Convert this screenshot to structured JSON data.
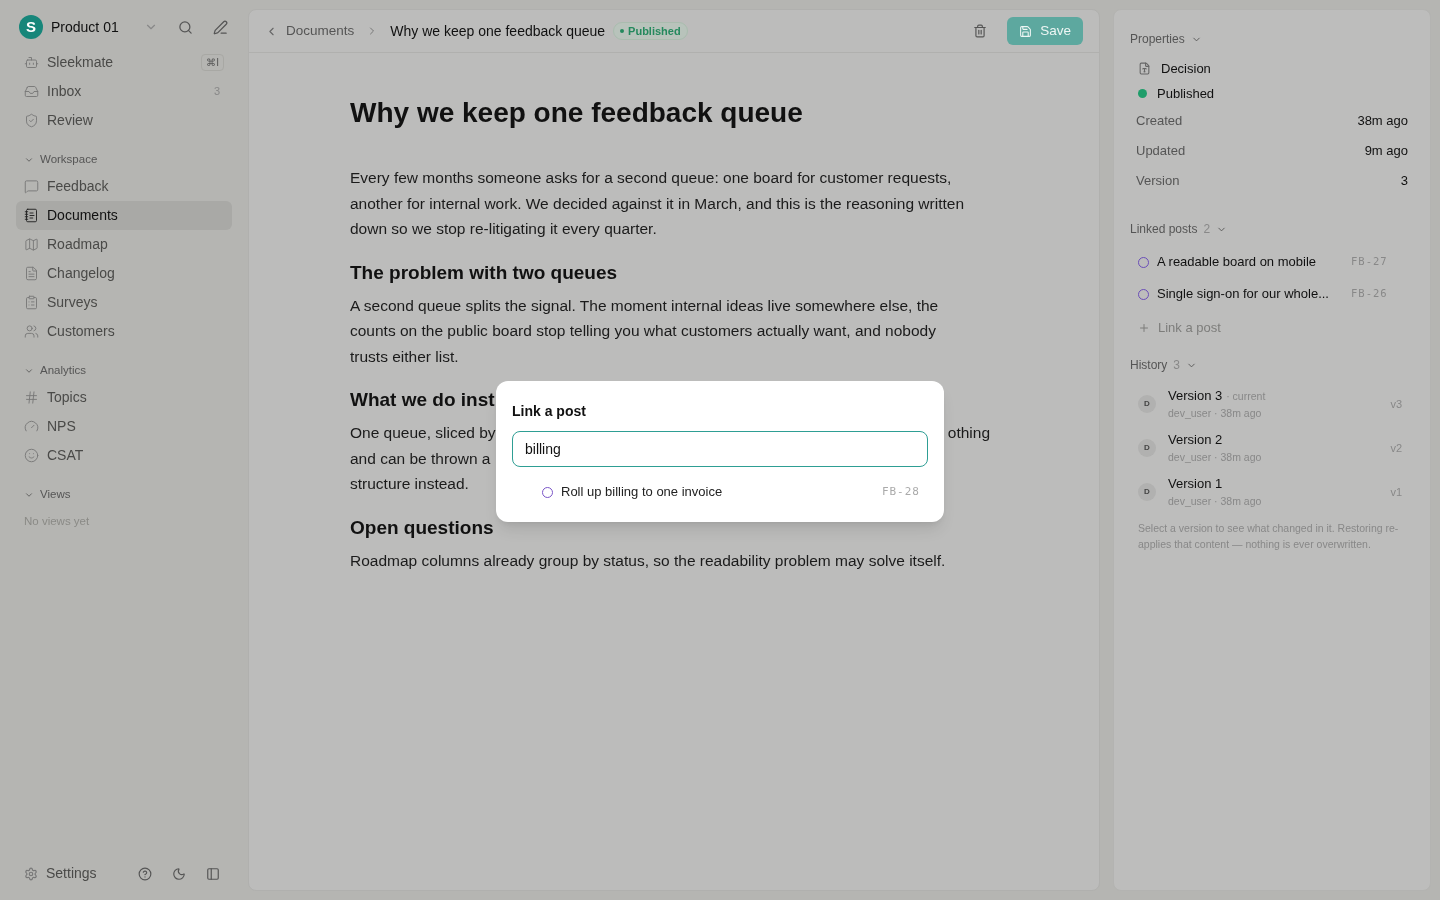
{
  "workspace": {
    "initial": "S",
    "name": "Product 01"
  },
  "sidebar": {
    "top_items": [
      {
        "label": "Sleekmate",
        "shortcut": "⌘I",
        "selected": false
      },
      {
        "label": "Inbox",
        "count": "3",
        "selected": false
      },
      {
        "label": "Review",
        "selected": false
      }
    ],
    "sections": [
      {
        "title": "Workspace",
        "expanded": true,
        "items": [
          {
            "label": "Feedback",
            "selected": false
          },
          {
            "label": "Documents",
            "selected": true
          },
          {
            "label": "Roadmap",
            "selected": false
          },
          {
            "label": "Changelog",
            "selected": false
          },
          {
            "label": "Surveys",
            "selected": false
          },
          {
            "label": "Customers",
            "selected": false
          }
        ]
      },
      {
        "title": "Analytics",
        "expanded": true,
        "items": [
          {
            "label": "Topics",
            "selected": false
          },
          {
            "label": "NPS",
            "selected": false
          },
          {
            "label": "CSAT",
            "selected": false
          }
        ]
      },
      {
        "title": "Views",
        "expanded": true,
        "empty_text": "No views yet"
      }
    ],
    "footer": {
      "settings": "Settings"
    }
  },
  "breadcrumb": {
    "parent": "Documents",
    "current": "Why we keep one feedback queue",
    "status": "Published"
  },
  "toolbar": {
    "save": "Save"
  },
  "document": {
    "title": "Why we keep one feedback queue",
    "blocks": [
      {
        "kind": "paragraph",
        "text": "Every few months someone asks for a second queue: one board for customer requests, another for internal work. We decided against it in March, and this is the reasoning written down so we stop re-litigating it every quarter."
      },
      {
        "kind": "heading",
        "text": "The problem with two queues"
      },
      {
        "kind": "paragraph",
        "text": "A second queue splits the signal. The moment internal ideas live somewhere else, the counts on the public board stop telling you what customers actually want, and nobody trusts either list."
      },
      {
        "kind": "heading",
        "text": "What we do inst"
      },
      {
        "kind": "lines",
        "lines": [
          {
            "left": "One queue, sliced by",
            "right": "othing"
          },
          {
            "left": "and can be thrown a"
          },
          {
            "left": "structure instead."
          }
        ]
      },
      {
        "kind": "heading",
        "text": "Open questions"
      },
      {
        "kind": "paragraph",
        "text": "Roadmap columns already group by status, so the readability problem may solve itself."
      }
    ]
  },
  "properties": {
    "title": "Properties",
    "type": "Decision",
    "status": "Published",
    "rows": [
      {
        "label": "Created",
        "value": "38m ago"
      },
      {
        "label": "Updated",
        "value": "9m ago"
      },
      {
        "label": "Version",
        "value": "3"
      }
    ]
  },
  "linked_posts": {
    "title": "Linked posts",
    "count": "2",
    "posts": [
      {
        "title": "A readable board on mobile",
        "id": "FB-27"
      },
      {
        "title": "Single sign-on for our whole...",
        "id": "FB-26"
      }
    ],
    "add": "Link a post"
  },
  "history": {
    "title": "History",
    "count": "3",
    "versions": [
      {
        "avatar": "D",
        "name": "Version 3",
        "tag": "· current",
        "meta": "dev_user · 38m ago",
        "short": "v3"
      },
      {
        "avatar": "D",
        "name": "Version 2",
        "meta": "dev_user · 38m ago",
        "short": "v2"
      },
      {
        "avatar": "D",
        "name": "Version 1",
        "meta": "dev_user · 38m ago",
        "short": "v1"
      }
    ],
    "note": "Select a version to see what changed in it. Restoring re-applies that content — nothing is ever overwritten."
  },
  "dialog": {
    "title": "Link a post",
    "query": "billing",
    "results": [
      {
        "title": "Roll up billing to one invoice",
        "id": "FB-28"
      }
    ]
  }
}
